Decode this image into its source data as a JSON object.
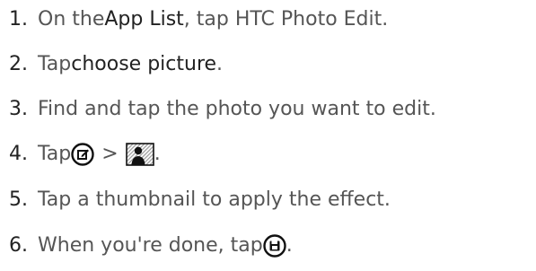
{
  "steps": [
    {
      "number": "1.",
      "pre": "On the ",
      "bold": "App List",
      "post": ", tap HTC Photo Edit."
    },
    {
      "number": "2.",
      "pre": "Tap ",
      "bold": "choose picture",
      "post": "."
    },
    {
      "number": "3.",
      "text": "Find and tap the photo you want to edit."
    },
    {
      "number": "4.",
      "pre": "Tap ",
      "separator": ">",
      "post": ".",
      "icons": [
        "edit-icon",
        "portrait-effect-icon"
      ]
    },
    {
      "number": "5.",
      "text": "Tap a thumbnail to apply the effect."
    },
    {
      "number": "6.",
      "pre": "When you're done, tap ",
      "post": ".",
      "icons": [
        "save-icon"
      ]
    }
  ],
  "colors": {
    "text": "#555555",
    "emphasis": "#222222",
    "icon": "#111111"
  }
}
